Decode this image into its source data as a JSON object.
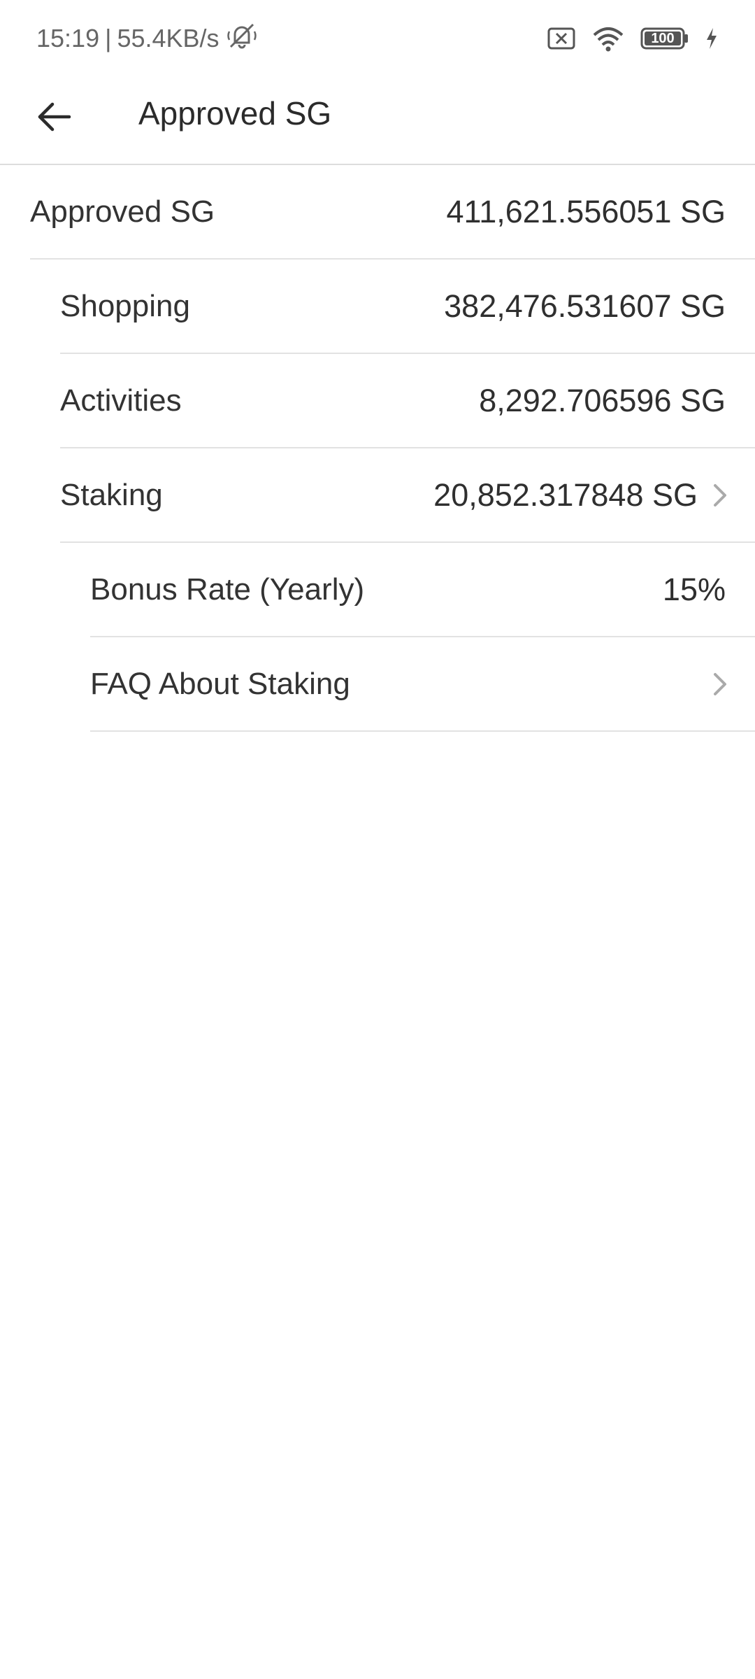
{
  "status_bar": {
    "time": "15:19",
    "separator": "|",
    "network_speed": "55.4KB/s",
    "battery": "100"
  },
  "app_bar": {
    "title": "Approved SG"
  },
  "rows": {
    "approved": {
      "label": "Approved SG",
      "value": "411,621.556051 SG"
    },
    "shopping": {
      "label": "Shopping",
      "value": "382,476.531607 SG"
    },
    "activities": {
      "label": "Activities",
      "value": "8,292.706596 SG"
    },
    "staking": {
      "label": "Staking",
      "value": "20,852.317848 SG"
    },
    "bonus_rate": {
      "label": "Bonus Rate (Yearly)",
      "value": "15%"
    },
    "faq": {
      "label": "FAQ About Staking"
    }
  },
  "colors": {
    "text": "#333333",
    "divider": "#e2e2e2",
    "chevron": "#aaaaaa"
  }
}
